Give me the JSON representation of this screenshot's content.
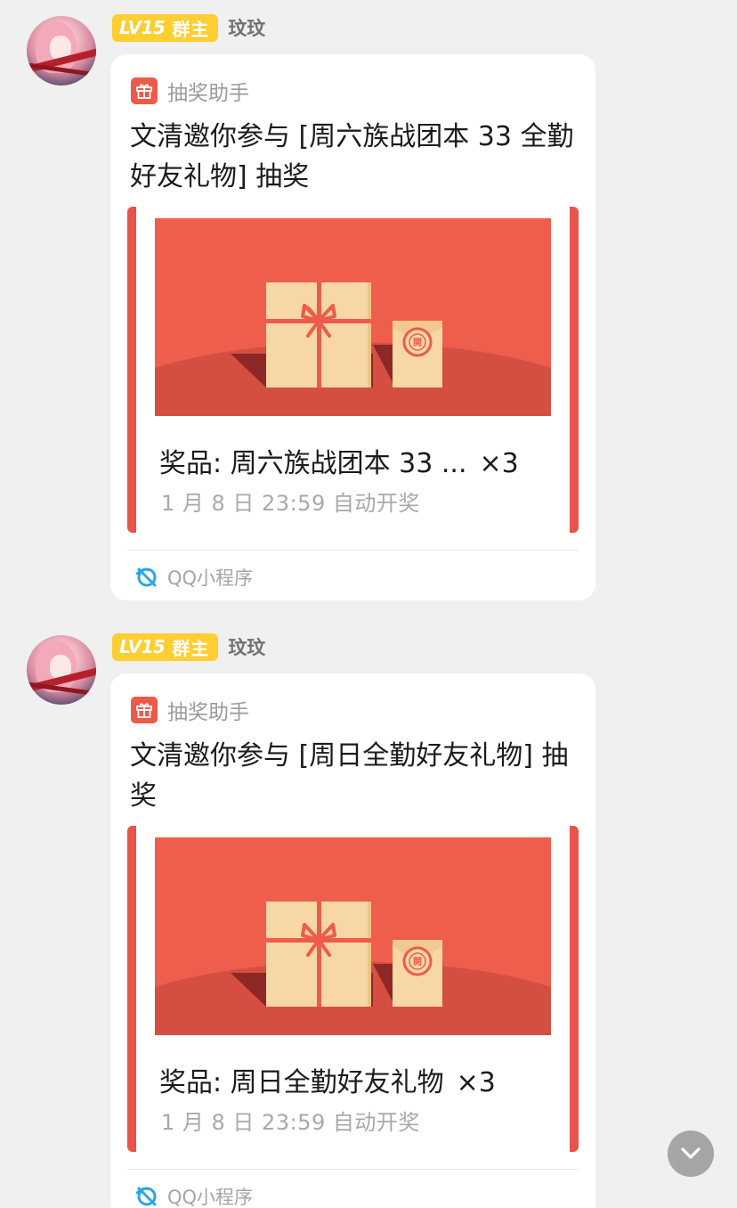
{
  "messages": [
    {
      "sender": {
        "level_badge": "LV15",
        "role_badge": "群主",
        "name": "玟玟"
      },
      "card": {
        "source_label": "抽奖助手",
        "title": "文清邀你参与 [周六族战团本 33 全勤好友礼物] 抽奖",
        "prize_label": "奖品: 周六族战团本 33 ...",
        "prize_quantity": "×3",
        "deadline": "1 月 8 日 23:59 自动开奖",
        "banner_seal_char": "開",
        "footer_label": "QQ小程序"
      }
    },
    {
      "sender": {
        "level_badge": "LV15",
        "role_badge": "群主",
        "name": "玟玟"
      },
      "card": {
        "source_label": "抽奖助手",
        "title": "文清邀你参与 [周日全勤好友礼物] 抽奖",
        "prize_label": "奖品: 周日全勤好友礼物",
        "prize_quantity": "×3",
        "deadline": "1 月 8 日 23:59 自动开奖",
        "banner_seal_char": "開",
        "footer_label": "QQ小程序"
      }
    }
  ],
  "colors": {
    "accent_red": "#e8534a",
    "banner_red": "#ef5e4d",
    "badge_yellow": "#ffce33",
    "gift_box": "#f7d7a6"
  },
  "icons": {
    "source": "gift-icon",
    "footer": "qq-miniprogram-icon",
    "scroll": "chevron-down-icon"
  }
}
